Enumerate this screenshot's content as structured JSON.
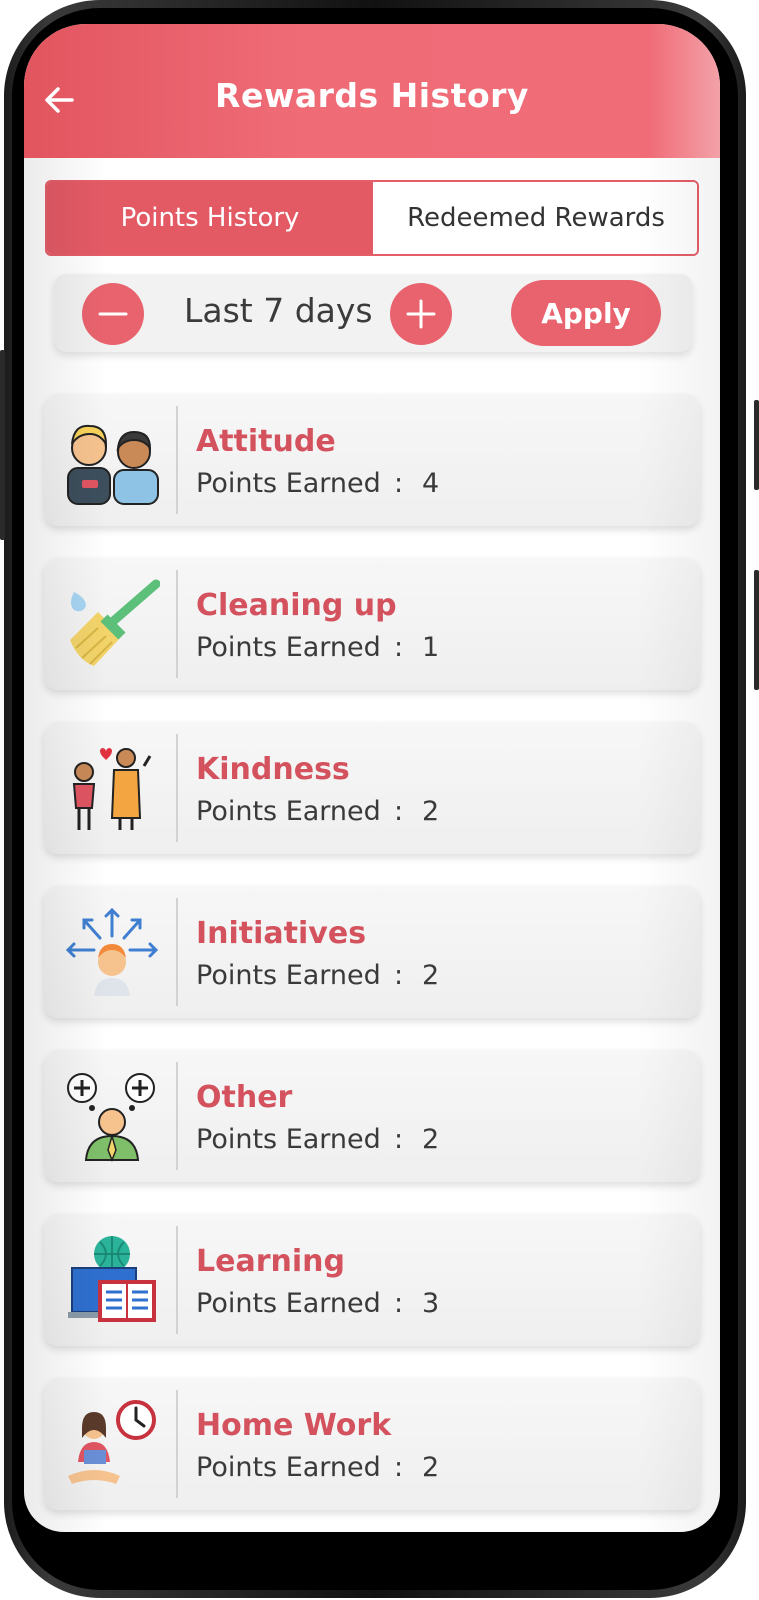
{
  "header": {
    "title": "Rewards History"
  },
  "tabs": [
    {
      "label": "Points History",
      "active": true
    },
    {
      "label": "Redeemed Rewards",
      "active": false
    }
  ],
  "filter": {
    "range_label": "Last 7 days",
    "apply_label": "Apply"
  },
  "points_label": "Points Earned",
  "separator": ":",
  "items": [
    {
      "category": "Attitude",
      "points": "4",
      "icon": "friends-icon"
    },
    {
      "category": "Cleaning up",
      "points": "1",
      "icon": "broom-icon"
    },
    {
      "category": "Kindness",
      "points": "2",
      "icon": "helping-elder-icon"
    },
    {
      "category": "Initiatives",
      "points": "2",
      "icon": "ideas-arrows-icon"
    },
    {
      "category": "Other",
      "points": "2",
      "icon": "thinking-person-icon"
    },
    {
      "category": "Learning",
      "points": "3",
      "icon": "online-learning-icon"
    },
    {
      "category": "Home Work",
      "points": "2",
      "icon": "study-clock-icon"
    }
  ],
  "colors": {
    "accent": "#ef6b77",
    "category_text": "#d3525d"
  }
}
